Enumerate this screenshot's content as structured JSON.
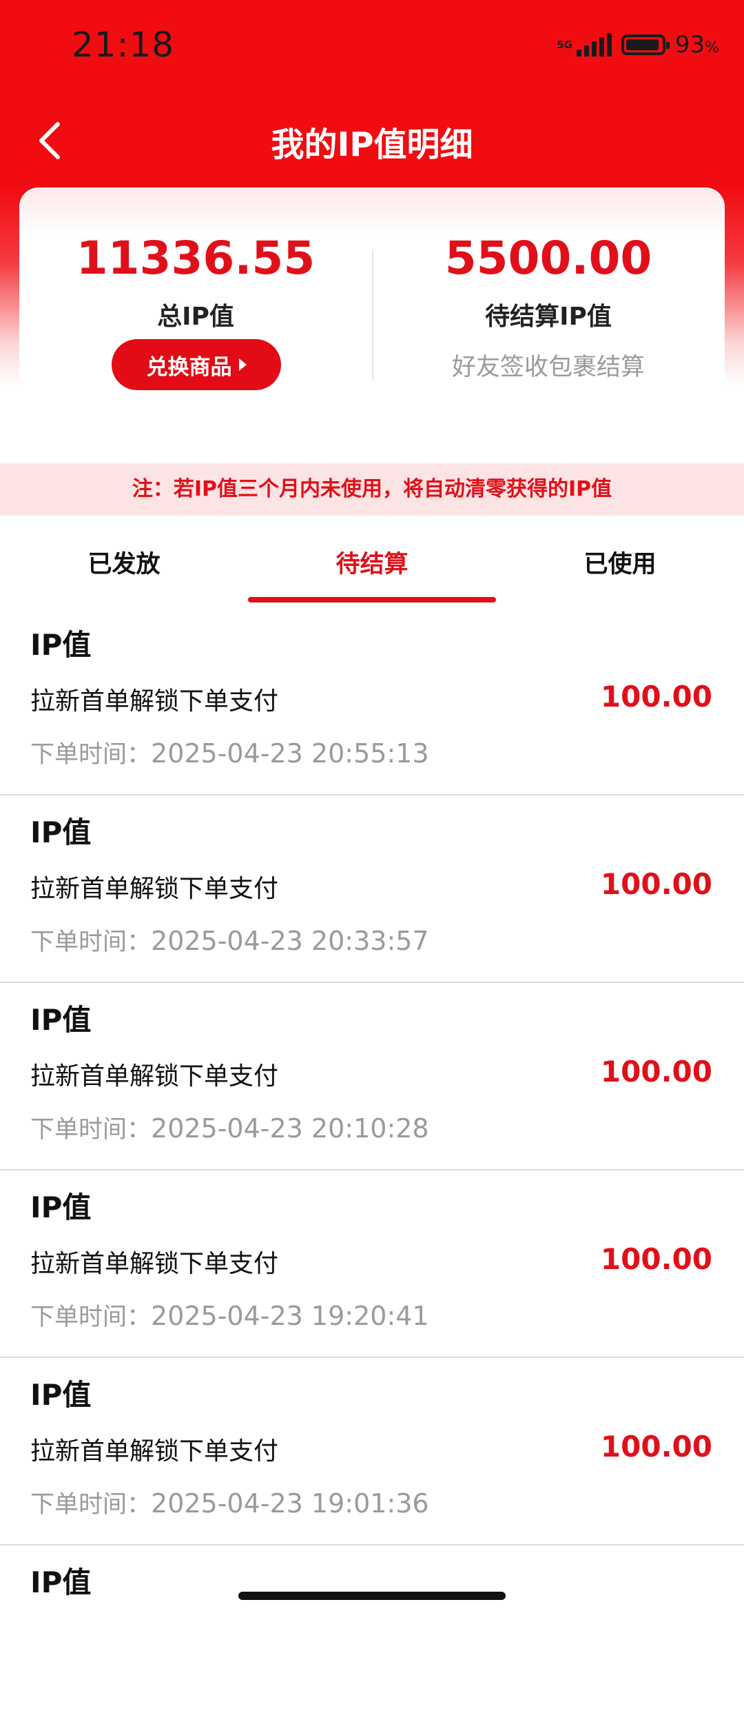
{
  "status_bar": {
    "time": "21:18",
    "network": "5G",
    "battery_percent": "93",
    "battery_unit": "%",
    "battery_level": 0.93
  },
  "nav": {
    "back_icon": "chevron-left-icon",
    "title": "我的IP值明细"
  },
  "summary": {
    "total_value": "11336.55",
    "total_label": "总IP值",
    "exchange_button": "兑换商品",
    "pending_value": "5500.00",
    "pending_label": "待结算IP值",
    "pending_note": "好友签收包裹结算"
  },
  "notice": "注：若IP值三个月内未使用，将自动清零获得的IP值",
  "tabs": [
    {
      "label": "已发放",
      "active": false
    },
    {
      "label": "待结算",
      "active": true
    },
    {
      "label": "已使用",
      "active": false
    }
  ],
  "records": [
    {
      "title": "IP值",
      "desc": "拉新首单解锁下单支付",
      "amount": "100.00",
      "time_label": "下单时间：",
      "time": "2025-04-23 20:55:13"
    },
    {
      "title": "IP值",
      "desc": "拉新首单解锁下单支付",
      "amount": "100.00",
      "time_label": "下单时间：",
      "time": "2025-04-23 20:33:57"
    },
    {
      "title": "IP值",
      "desc": "拉新首单解锁下单支付",
      "amount": "100.00",
      "time_label": "下单时间：",
      "time": "2025-04-23 20:10:28"
    },
    {
      "title": "IP值",
      "desc": "拉新首单解锁下单支付",
      "amount": "100.00",
      "time_label": "下单时间：",
      "time": "2025-04-23 19:20:41"
    },
    {
      "title": "IP值",
      "desc": "拉新首单解锁下单支付",
      "amount": "100.00",
      "time_label": "下单时间：",
      "time": "2025-04-23 19:01:36"
    },
    {
      "title": "IP值"
    }
  ],
  "colors": {
    "brand_red": "#e0101a",
    "header_red": "#f10c12",
    "notice_bg": "#fde4e4",
    "muted_text": "#9a9a9a"
  }
}
